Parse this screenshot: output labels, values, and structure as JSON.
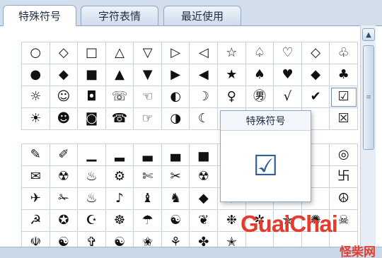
{
  "tabs": [
    {
      "label": "特殊符号",
      "active": true
    },
    {
      "label": "字符表情",
      "active": false
    },
    {
      "label": "最近使用",
      "active": false
    }
  ],
  "grid_top": [
    [
      "○",
      "◇",
      "□",
      "△",
      "▽",
      "▷",
      "◁",
      "☆",
      "♤",
      "♡",
      "◇",
      "♧"
    ],
    [
      "●",
      "◆",
      "■",
      "▲",
      "▼",
      "▶",
      "◀",
      "★",
      "♠",
      "♥",
      "◆",
      "♣"
    ],
    [
      "☼",
      "☺",
      "◘",
      "☏",
      "☜",
      "◐",
      "☽",
      "♀",
      "㊚",
      "√",
      "✔",
      "☑"
    ],
    [
      "☀",
      "☻",
      "◙",
      "☎",
      "☞",
      "◑",
      "☾",
      "♂",
      "",
      "",
      "",
      "☒"
    ]
  ],
  "grid_bottom": [
    [
      "✎",
      "✐",
      "▁",
      "▂",
      "▃",
      "▄",
      "▅",
      "▆",
      "",
      "",
      "",
      "◎"
    ],
    [
      "✉",
      "☢",
      "♨",
      "⚙",
      "✄",
      "✂",
      "☢",
      "♞",
      "",
      "",
      "",
      "卐"
    ],
    [
      "✈",
      "✁",
      "♨",
      "♪",
      "♝",
      "♞",
      "◆",
      "✤",
      "",
      "",
      "",
      "☮"
    ],
    [
      "☭",
      "✪",
      "☪",
      "☸",
      "☂",
      "☯",
      "❦",
      "❉",
      "✲",
      "✯",
      "✺",
      "☠"
    ],
    [
      "☫",
      "☯",
      "✞",
      "☯",
      "✬",
      "⚘",
      "✤",
      "✭",
      "",
      "",
      "",
      ""
    ]
  ],
  "popup": {
    "title": "特殊符号",
    "symbol": "☑"
  },
  "scrollbar": {
    "up_arrow": "▲",
    "thumb_grip": "≡"
  },
  "watermark": {
    "text": "GuaiChai",
    "sub": "怪柴网"
  },
  "colors": {
    "accent": "#2f5f98",
    "border": "#8fa7c6",
    "watermark": "#e43b2c"
  }
}
